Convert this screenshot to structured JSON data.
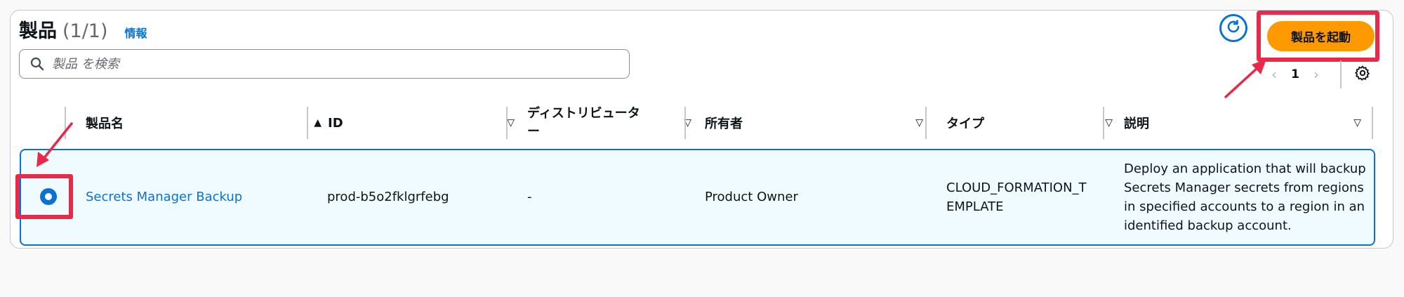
{
  "header": {
    "title": "製品",
    "count": "(1/1)",
    "info_link": "情報",
    "launch_button": "製品を起動"
  },
  "search": {
    "placeholder": "製品 を検索"
  },
  "pagination": {
    "prev": "‹",
    "page": "1",
    "next": "›"
  },
  "table": {
    "columns": [
      "製品名",
      "ID",
      "ディストリビュータ\nー",
      "所有者",
      "タイプ",
      "説明"
    ],
    "sort_indicators": {
      "sorted": "▲",
      "unsorted": "▽"
    },
    "rows": [
      {
        "name": "Secrets Manager Backup",
        "id": "prod-b5o2fklgrfebg",
        "distributor": "-",
        "owner": "Product Owner",
        "type": "CLOUD_FORMATION_T\nEMPLATE",
        "description": "Deploy an application that will backup Secrets Manager secrets from regions in specified accounts to a region in an identified backup account.",
        "selected": true
      }
    ]
  },
  "icons": {
    "search": "search-icon",
    "refresh": "refresh-icon",
    "settings": "gear-icon"
  },
  "colors": {
    "accent": "#0972d3",
    "launch_button": "#ff9900",
    "highlight": "#e8294a",
    "selected_row_bg": "#f0fbff"
  }
}
